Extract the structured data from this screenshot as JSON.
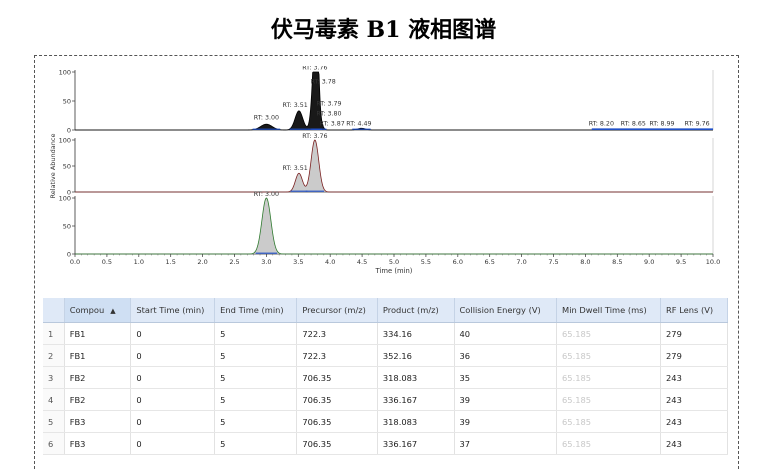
{
  "title": "伏马毒素 B1 液相图谱",
  "chart_data": [
    {
      "type": "line",
      "panel": "1",
      "ylabel": "Relative Abundance",
      "yticks": [
        "100",
        "50",
        "0"
      ],
      "ylim": [
        0,
        100
      ],
      "xlim": [
        0,
        10
      ],
      "peaks": [
        {
          "rt": 3.0,
          "height": 10,
          "width": 0.09
        },
        {
          "rt": 3.51,
          "height": 33,
          "width": 0.06
        },
        {
          "rt": 3.76,
          "height": 100,
          "width": 0.045
        },
        {
          "rt": 3.78,
          "height": 74,
          "width": 0.035
        },
        {
          "rt": 3.79,
          "height": 30,
          "width": 0.03
        },
        {
          "rt": 3.8,
          "height": 16,
          "width": 0.03
        },
        {
          "rt": 3.87,
          "height": 5,
          "width": 0.03
        },
        {
          "rt": 4.49,
          "height": 3,
          "width": 0.06
        }
      ],
      "annotations": [
        {
          "text": "RT: 3.76",
          "x": 3.76,
          "y": 104
        },
        {
          "text": "RT: 3.78",
          "x": 3.89,
          "y": 80
        },
        {
          "text": "RT: 3.51",
          "x": 3.45,
          "y": 40
        },
        {
          "text": "RT: 3.79",
          "x": 3.98,
          "y": 42
        },
        {
          "text": "RT: 3.80",
          "x": 3.98,
          "y": 25
        },
        {
          "text": "RT: 3.00",
          "x": 3.0,
          "y": 18
        },
        {
          "text": "RT: 3.87",
          "x": 4.03,
          "y": 8
        },
        {
          "text": "RT: 4.49",
          "x": 4.45,
          "y": 8
        },
        {
          "text": "RT: 8.20",
          "x": 8.25,
          "y": 8
        },
        {
          "text": "RT: 8.65",
          "x": 8.75,
          "y": 8
        },
        {
          "text": "RT: 8.99",
          "x": 9.2,
          "y": 8
        },
        {
          "text": "RT: 9.76",
          "x": 9.75,
          "y": 8
        }
      ],
      "color": "#000000",
      "fill": "#000000"
    },
    {
      "type": "line",
      "panel": "2",
      "yticks": [
        "100",
        "50",
        "0"
      ],
      "ylim": [
        0,
        100
      ],
      "xlim": [
        0,
        10
      ],
      "peaks": [
        {
          "rt": 3.51,
          "height": 36,
          "width": 0.055
        },
        {
          "rt": 3.76,
          "height": 100,
          "width": 0.06
        }
      ],
      "annotations": [
        {
          "text": "RT: 3.76",
          "x": 3.76,
          "y": 104
        },
        {
          "text": "RT: 3.51",
          "x": 3.45,
          "y": 42
        }
      ],
      "color": "#7a2020",
      "fill": "#b9b9b9"
    },
    {
      "type": "line",
      "panel": "3",
      "yticks": [
        "100",
        "50",
        "0"
      ],
      "ylim": [
        0,
        100
      ],
      "xlim": [
        0,
        10
      ],
      "xlabel": "Time (min)",
      "xticks": [
        "0.0",
        "0.5",
        "1.0",
        "1.5",
        "2.0",
        "2.5",
        "3.0",
        "3.5",
        "4.0",
        "4.5",
        "5.0",
        "5.5",
        "6.0",
        "6.5",
        "7.0",
        "7.5",
        "8.0",
        "8.5",
        "9.0",
        "9.5",
        "10.0"
      ],
      "peaks": [
        {
          "rt": 3.0,
          "height": 100,
          "width": 0.07
        }
      ],
      "annotations": [
        {
          "text": "RT: 3.00",
          "x": 3.0,
          "y": 104
        }
      ],
      "color": "#2f7a2f",
      "fill": "#b9b9b9"
    }
  ],
  "table": {
    "columns": [
      "Compou",
      "Start Time (min)",
      "End Time (min)",
      "Precursor (m/z)",
      "Product (m/z)",
      "Collision Energy (V)",
      "Min Dwell Time (ms)",
      "RF Lens (V)"
    ],
    "rows": [
      [
        "1",
        "FB1",
        "0",
        "5",
        "722.3",
        "334.16",
        "40",
        "65.185",
        "279"
      ],
      [
        "2",
        "FB1",
        "0",
        "5",
        "722.3",
        "352.16",
        "36",
        "65.185",
        "279"
      ],
      [
        "3",
        "FB2",
        "0",
        "5",
        "706.35",
        "318.083",
        "35",
        "65.185",
        "243"
      ],
      [
        "4",
        "FB2",
        "0",
        "5",
        "706.35",
        "336.167",
        "39",
        "65.185",
        "243"
      ],
      [
        "5",
        "FB3",
        "0",
        "5",
        "706.35",
        "318.083",
        "39",
        "65.185",
        "243"
      ],
      [
        "6",
        "FB3",
        "0",
        "5",
        "706.35",
        "336.167",
        "37",
        "65.185",
        "243"
      ]
    ]
  }
}
